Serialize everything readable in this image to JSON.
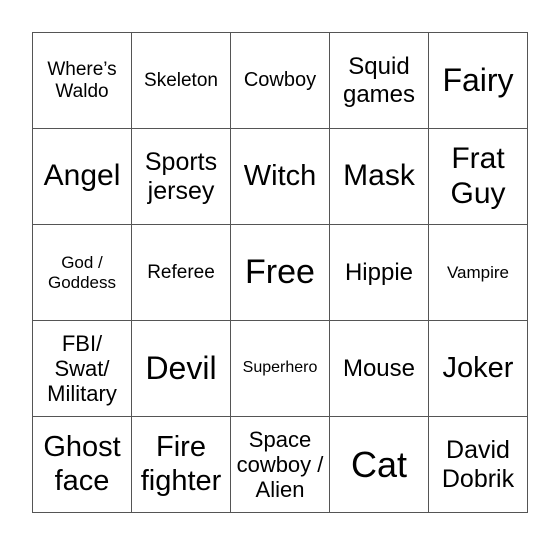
{
  "board": {
    "rows": [
      [
        "Where’s Waldo",
        "Skeleton",
        "Cowboy",
        "Squid games",
        "Fairy"
      ],
      [
        "Angel",
        "Sports jersey",
        "Witch",
        "Mask",
        "Frat Guy"
      ],
      [
        "God / Goddess",
        "Referee",
        "Free",
        "Hippie",
        "Vampire"
      ],
      [
        "FBI/ Swat/ Military",
        "Devil",
        "Superhero",
        "Mouse",
        "Joker"
      ],
      [
        "Ghost face",
        "Fire fighter",
        "Space cowboy / Alien",
        "Cat",
        "David Dobrik"
      ]
    ],
    "free_space": "Free"
  }
}
